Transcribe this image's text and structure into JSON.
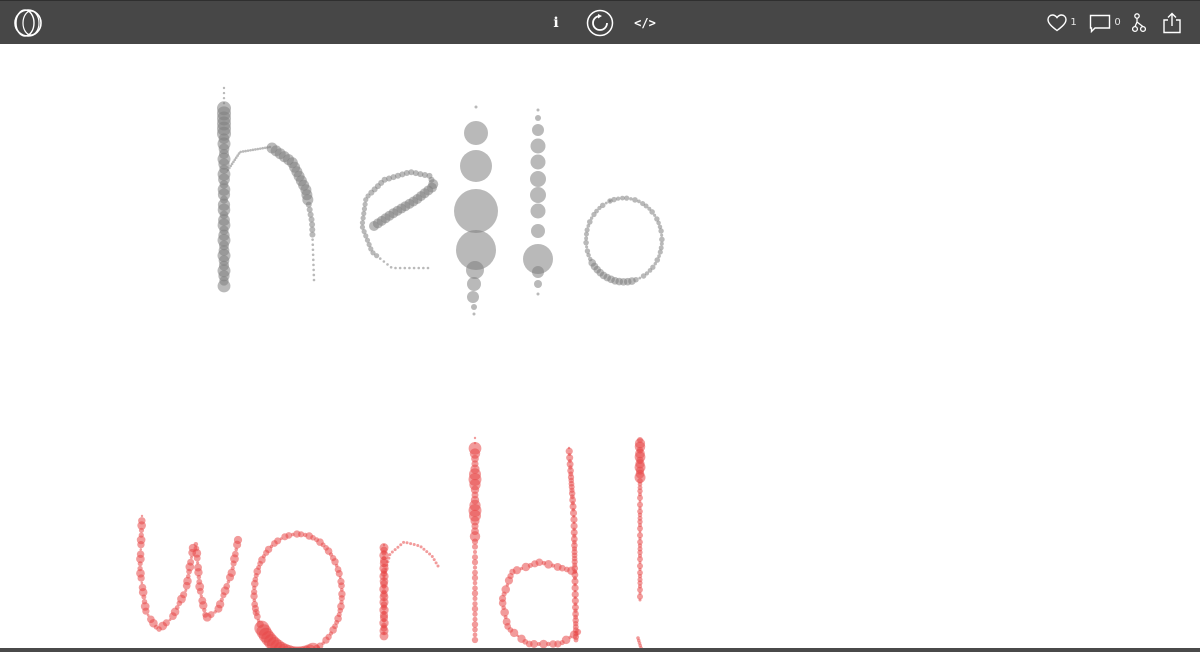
{
  "toolbar": {
    "logo_icon": "openprocessing-logo-icon",
    "info_label": "i",
    "restart_icon": "restart-icon",
    "code_label": "</>",
    "like_icon": "heart-icon",
    "like_count": "1",
    "comment_icon": "comment-icon",
    "comment_count": "0",
    "fork_icon": "fork-icon",
    "share_icon": "share-icon"
  },
  "colors": {
    "toolbar_bg": "#474747",
    "canvas_bg": "#ffffff",
    "hello_dots": "#808080",
    "world_dots": "#e84848"
  },
  "sketch": {
    "lines": [
      "hello",
      "world!"
    ]
  }
}
